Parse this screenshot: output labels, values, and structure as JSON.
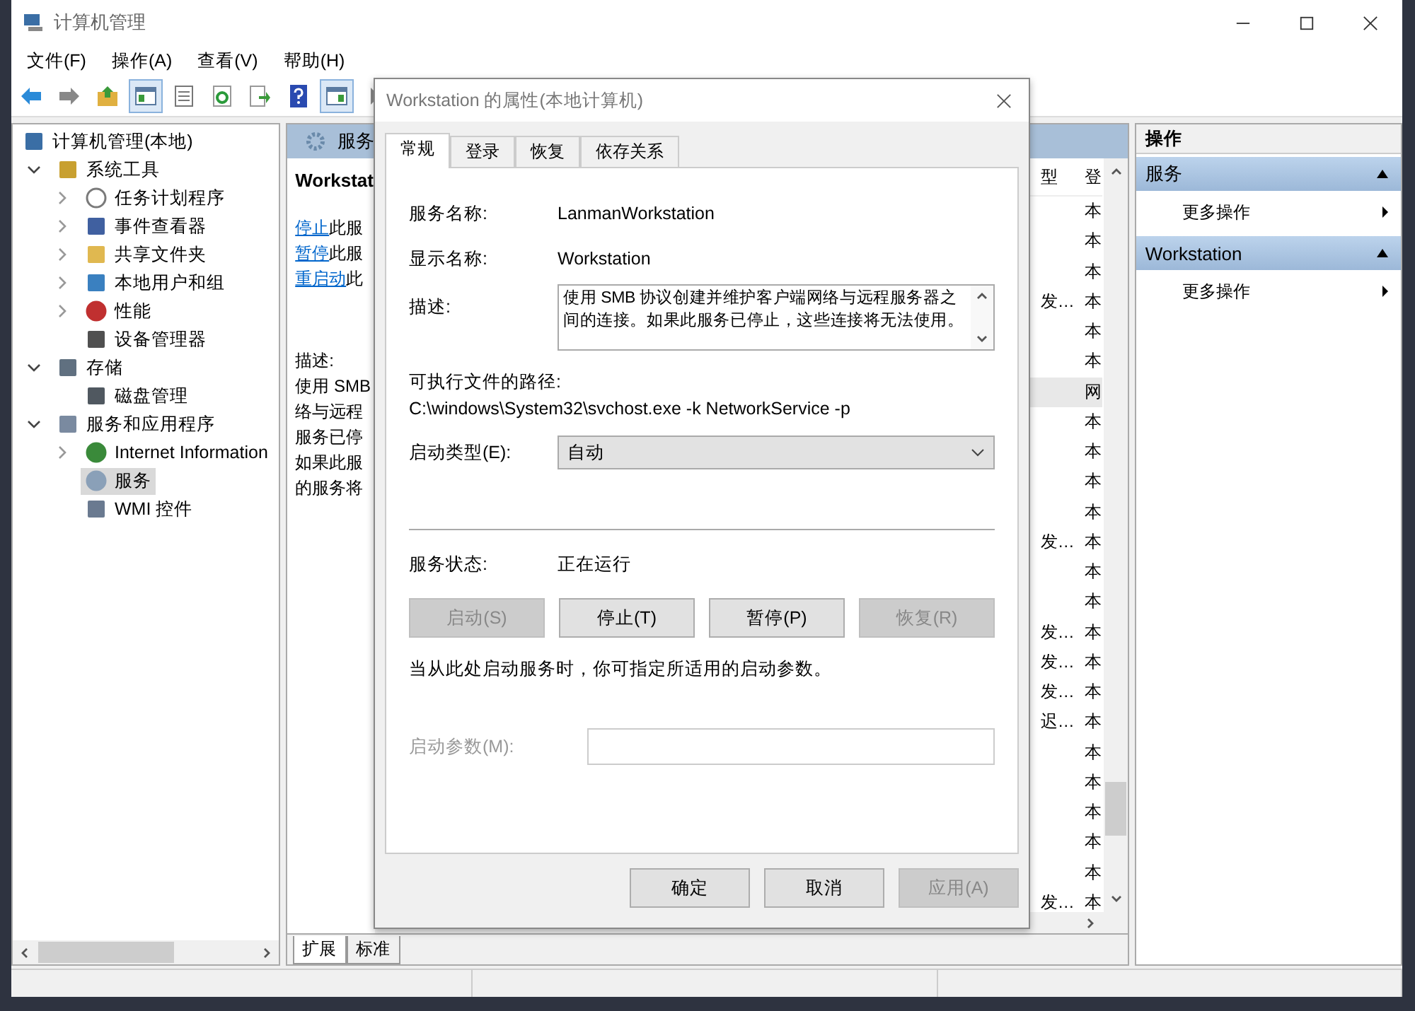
{
  "window": {
    "title": "计算机管理"
  },
  "menu": [
    "文件(F)",
    "操作(A)",
    "查看(V)",
    "帮助(H)"
  ],
  "toolbar": [
    {
      "kind": "back",
      "pressed": false
    },
    {
      "kind": "forward",
      "pressed": false
    },
    {
      "kind": "up",
      "pressed": false
    },
    {
      "kind": "tree",
      "pressed": true
    },
    {
      "kind": "sheet",
      "pressed": false
    },
    {
      "kind": "refresh",
      "pressed": false
    },
    {
      "kind": "export",
      "pressed": false
    },
    {
      "kind": "help",
      "pressed": false
    },
    {
      "kind": "pane",
      "pressed": true
    },
    {
      "kind": "play",
      "pressed": false
    }
  ],
  "tree": {
    "label": "计算机管理(本地)",
    "kind": "computer",
    "selected": false,
    "children": [
      {
        "label": "系统工具",
        "kind": "tools",
        "expanded": true,
        "selected": false,
        "children": [
          {
            "label": "任务计划程序",
            "kind": "clock",
            "expanded": false,
            "selected": false
          },
          {
            "label": "事件查看器",
            "kind": "log",
            "expanded": false,
            "selected": false
          },
          {
            "label": "共享文件夹",
            "kind": "folder",
            "expanded": false,
            "selected": false
          },
          {
            "label": "本地用户和组",
            "kind": "users",
            "expanded": false,
            "selected": false
          },
          {
            "label": "性能",
            "kind": "gauge",
            "expanded": false,
            "selected": false
          },
          {
            "label": "设备管理器",
            "kind": "device",
            "selected": false
          }
        ]
      },
      {
        "label": "存储",
        "kind": "storage",
        "expanded": true,
        "selected": false,
        "children": [
          {
            "label": "磁盘管理",
            "kind": "disk",
            "selected": false
          }
        ]
      },
      {
        "label": "服务和应用程序",
        "kind": "apps",
        "expanded": true,
        "selected": false,
        "children": [
          {
            "label": "Internet Information",
            "kind": "globe",
            "expanded": false,
            "selected": false
          },
          {
            "label": "服务",
            "kind": "gear",
            "selected": true
          },
          {
            "label": "WMI 控件",
            "kind": "wmi",
            "selected": false
          }
        ]
      }
    ]
  },
  "services": {
    "header": "服务",
    "detail": {
      "title": "Workstat",
      "links": [
        {
          "link": "停止",
          "text": "此服"
        },
        {
          "link": "暂停",
          "text": "此服"
        },
        {
          "link": "重启动",
          "text": "此"
        }
      ],
      "desc_label": "描述:",
      "desc_lines": [
        "使用 SMB",
        "络与远程",
        "服务已停",
        "如果此服",
        "的服务将"
      ]
    },
    "columns": [
      "型",
      "登"
    ],
    "rows": [
      {
        "logon": "本",
        "selected": false
      },
      {
        "logon": "本",
        "selected": false
      },
      {
        "logon": "本",
        "selected": false
      },
      {
        "type": "发…",
        "logon": "本",
        "selected": false
      },
      {
        "logon": "本",
        "selected": false
      },
      {
        "logon": "本",
        "selected": false
      },
      {
        "logon": "网",
        "selected": true
      },
      {
        "logon": "本",
        "selected": false
      },
      {
        "logon": "本",
        "selected": false
      },
      {
        "logon": "本",
        "selected": false
      },
      {
        "logon": "本",
        "selected": false
      },
      {
        "type": "发…",
        "logon": "本",
        "selected": false
      },
      {
        "logon": "本",
        "selected": false
      },
      {
        "logon": "本",
        "selected": false
      },
      {
        "type": "发…",
        "logon": "本",
        "selected": false
      },
      {
        "type": "发…",
        "logon": "本",
        "selected": false
      },
      {
        "type": "发…",
        "logon": "本",
        "selected": false
      },
      {
        "type": "迟…",
        "logon": "本",
        "selected": false
      },
      {
        "logon": "本",
        "selected": false
      },
      {
        "logon": "本",
        "selected": false
      },
      {
        "logon": "本",
        "selected": false
      },
      {
        "logon": "本",
        "selected": false
      },
      {
        "logon": "本",
        "selected": false
      },
      {
        "type": "发…",
        "logon": "本",
        "selected": false
      }
    ],
    "view_tabs": [
      {
        "label": "扩展",
        "selected": true
      },
      {
        "label": "标准",
        "selected": false
      }
    ]
  },
  "actions": {
    "title": "操作",
    "sections": [
      {
        "title": "服务",
        "expanded": true,
        "items": [
          "更多操作"
        ]
      },
      {
        "title": "Workstation",
        "expanded": true,
        "items": [
          "更多操作"
        ]
      }
    ]
  },
  "dialog": {
    "title": "Workstation 的属性(本地计算机)",
    "tabs": [
      {
        "label": "常规",
        "selected": true
      },
      {
        "label": "登录",
        "selected": false
      },
      {
        "label": "恢复",
        "selected": false
      },
      {
        "label": "依存关系",
        "selected": false
      }
    ],
    "service_name_label": "服务名称:",
    "service_name": "LanmanWorkstation",
    "display_name_label": "显示名称:",
    "display_name": "Workstation",
    "description_label": "描述:",
    "description": "使用 SMB 协议创建并维护客户端网络与远程服务器之间的连接。如果此服务已停止，这些连接将无法使用。",
    "path_label": "可执行文件的路径:",
    "path": "C:\\windows\\System32\\svchost.exe -k NetworkService -p",
    "startup_type_label": "启动类型(E):",
    "startup_type": "自动",
    "status_label": "服务状态:",
    "status": "正在运行",
    "control_buttons": [
      {
        "label": "启动(S)",
        "disabled": true
      },
      {
        "label": "停止(T)",
        "disabled": false
      },
      {
        "label": "暂停(P)",
        "disabled": false
      },
      {
        "label": "恢复(R)",
        "disabled": true
      }
    ],
    "hint": "当从此处启动服务时，你可指定所适用的启动参数。",
    "params_label": "启动参数(M):",
    "params_disabled": true,
    "buttons": [
      {
        "label": "确定",
        "disabled": false
      },
      {
        "label": "取消",
        "disabled": false
      },
      {
        "label": "应用(A)",
        "disabled": true
      }
    ]
  }
}
